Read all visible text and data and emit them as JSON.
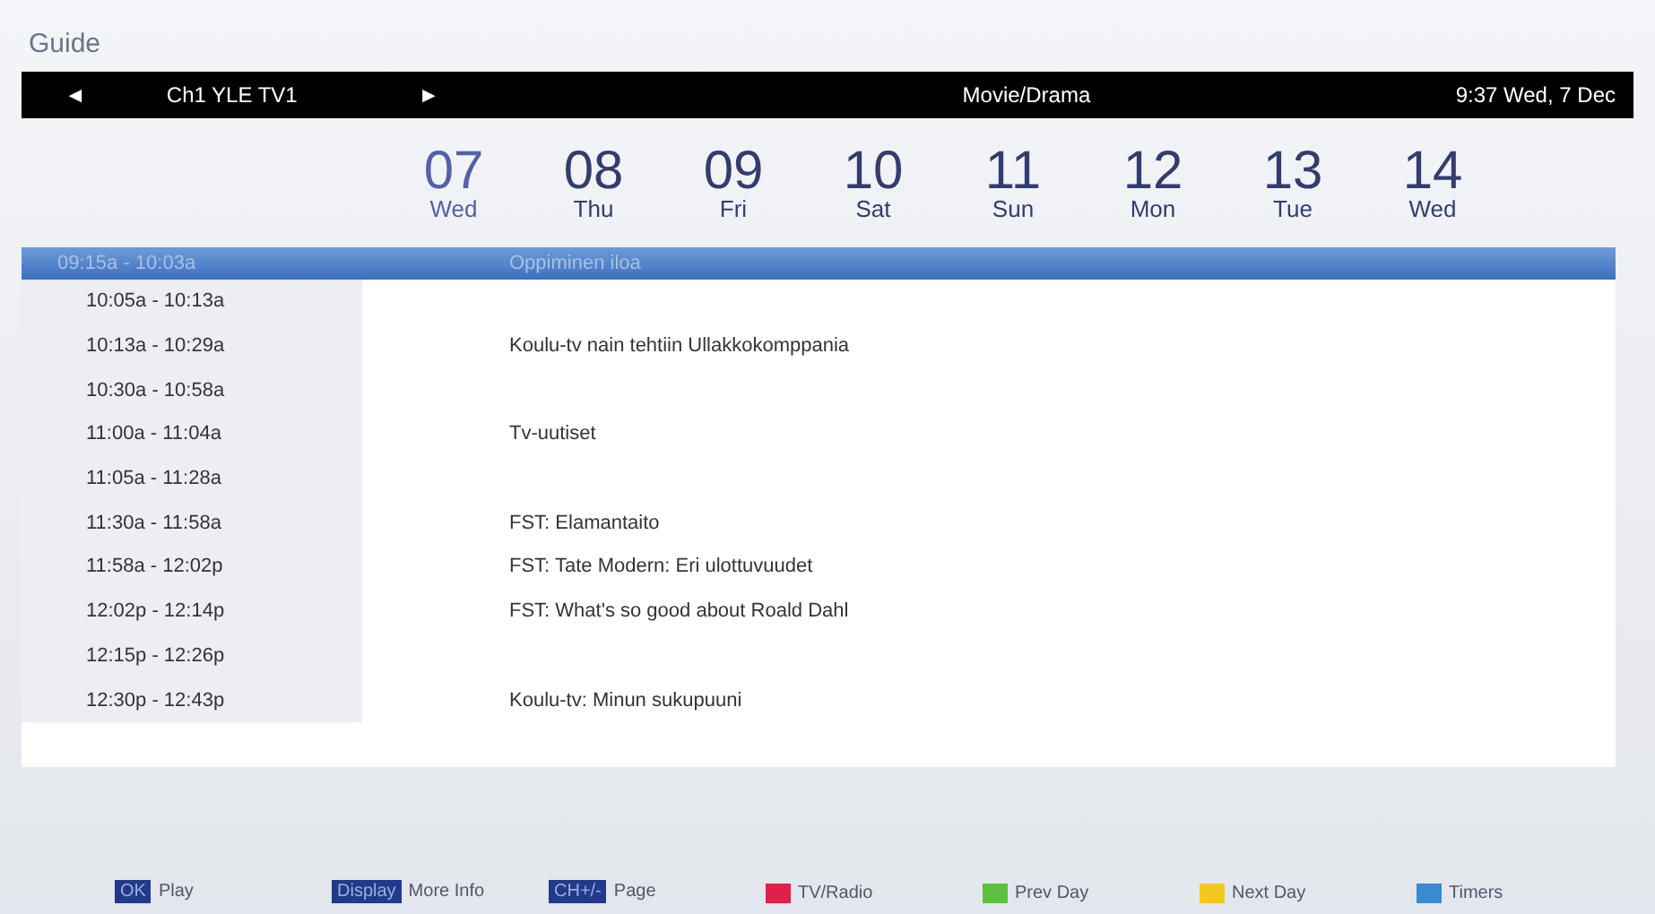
{
  "title": "Guide",
  "channel_bar": {
    "prev": "◄",
    "channel": "Ch1 YLE TV1",
    "next": "►",
    "genre": "Movie/Drama",
    "clock": "9:37 Wed, 7 Dec"
  },
  "days": [
    {
      "date": "07",
      "day": "Wed",
      "selected": true
    },
    {
      "date": "08",
      "day": "Thu",
      "selected": false
    },
    {
      "date": "09",
      "day": "Fri",
      "selected": false
    },
    {
      "date": "10",
      "day": "Sat",
      "selected": false
    },
    {
      "date": "11",
      "day": "Sun",
      "selected": false
    },
    {
      "date": "12",
      "day": "Mon",
      "selected": false
    },
    {
      "date": "13",
      "day": "Tue",
      "selected": false
    },
    {
      "date": "14",
      "day": "Wed",
      "selected": false
    }
  ],
  "programs": [
    {
      "time": "09:15a - 10:03a",
      "title": "Oppiminen iloa",
      "selected": true
    },
    {
      "time": "10:05a - 10:13a",
      "selected": false
    },
    {
      "time": "10:13a - 10:29a",
      "title": "Koulu-tv nain tehtiin Ullakkokomppania",
      "selected": false
    },
    {
      "time": "10:30a - 10:58a",
      "selected": false
    },
    {
      "time": "11:00a - 11:04a",
      "title": "Tv-uutiset",
      "selected": false
    },
    {
      "time": "11:05a - 11:28a",
      "selected": false
    },
    {
      "time": "11:30a - 11:58a",
      "title": "FST: Elamantaito",
      "selected": false
    },
    {
      "time": "11:58a - 12:02p",
      "title": "FST: Tate Modern: Eri ulottuvuudet",
      "selected": false
    },
    {
      "time": "12:02p - 12:14p",
      "title": "FST: What's so good about Roald Dahl",
      "selected": false
    },
    {
      "time": "12:15p - 12:26p",
      "selected": false
    },
    {
      "time": "12:30p - 12:43p",
      "title": "Koulu-tv: Minun sukupuuni",
      "selected": false
    }
  ],
  "footer": [
    {
      "kind": "key",
      "key": "OK",
      "label": "Play"
    },
    {
      "kind": "key",
      "key": "Display",
      "label": "More Info"
    },
    {
      "kind": "key",
      "key": "CH+/-",
      "label": "Page"
    },
    {
      "kind": "color",
      "color": "#e0204a",
      "label": "TV/Radio"
    },
    {
      "kind": "color",
      "color": "#5cc040",
      "label": "Prev Day"
    },
    {
      "kind": "color",
      "color": "#f4c820",
      "label": "Next Day"
    },
    {
      "kind": "color",
      "color": "#3a8ad0",
      "label": "Timers"
    }
  ]
}
